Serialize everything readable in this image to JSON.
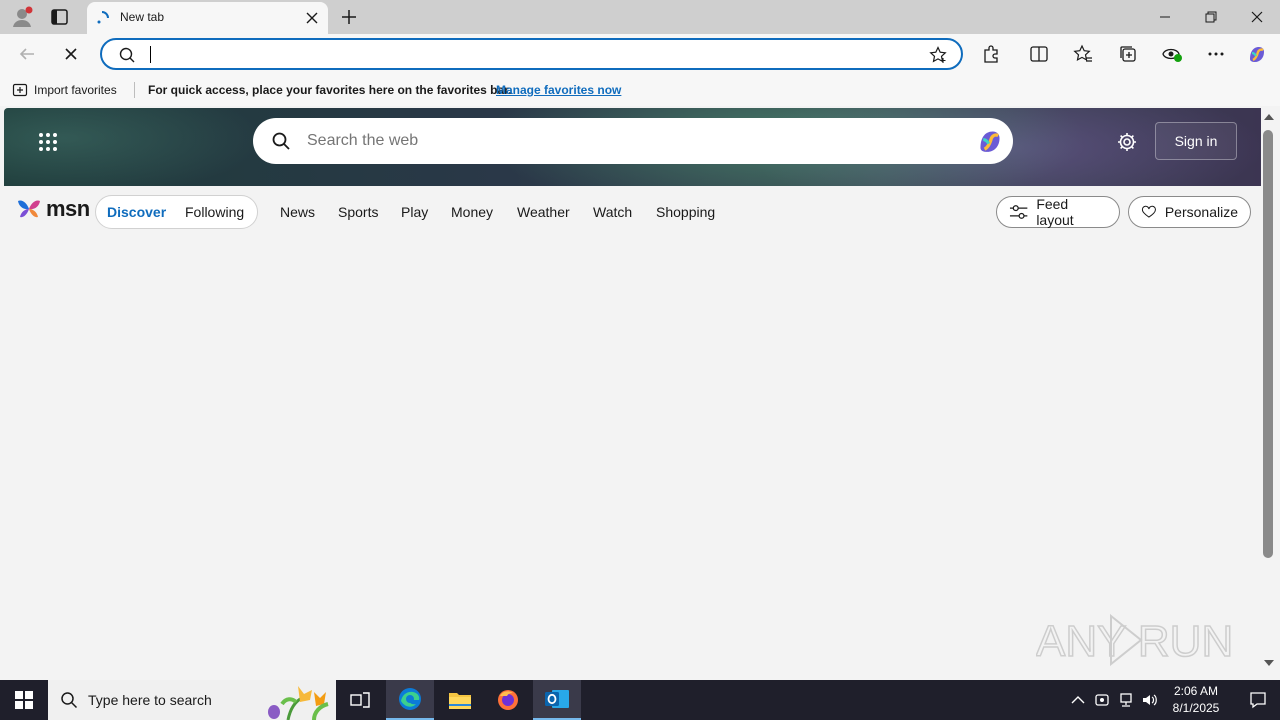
{
  "browser": {
    "tab": {
      "title": "New tab"
    },
    "address_bar": {
      "value": "",
      "placeholder": ""
    },
    "favorites_bar": {
      "import_label": "Import favorites",
      "message": "For quick access, place your favorites here on the favorites bar.",
      "link_label": "Manage favorites now"
    }
  },
  "msn": {
    "search_placeholder": "Search the web",
    "signin_label": "Sign in",
    "logo_text": "msn",
    "pill": {
      "discover": "Discover",
      "following": "Following"
    },
    "nav": [
      "News",
      "Sports",
      "Play",
      "Money",
      "Weather",
      "Watch",
      "Shopping"
    ],
    "feed_layout_label": "Feed layout",
    "personalize_label": "Personalize"
  },
  "watermark": {
    "text": "ANY RUN"
  },
  "taskbar": {
    "search_text": "Type here to search",
    "time": "2:06 AM",
    "date": "8/1/2025"
  },
  "colors": {
    "accent": "#0f6cbd",
    "taskbar": "#1f1f2b"
  }
}
